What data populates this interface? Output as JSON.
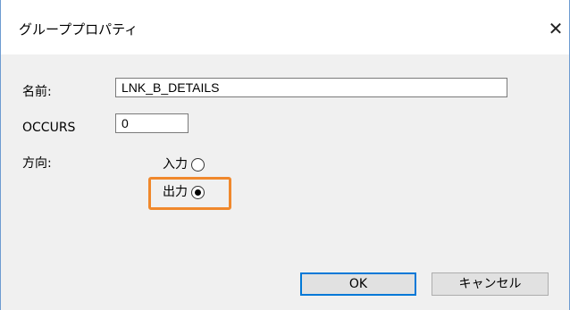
{
  "dialog": {
    "title": "グループプロパティ",
    "close_symbol": "✕"
  },
  "fields": {
    "name_label": "名前:",
    "name_value": "LNK_B_DETAILS",
    "occurs_label": "OCCURS",
    "occurs_value": "0",
    "direction_label": "方向:"
  },
  "direction": {
    "options": [
      {
        "label": "入力",
        "checked": false
      },
      {
        "label": "出力",
        "checked": true
      }
    ],
    "highlight_color": "#f0882c"
  },
  "buttons": {
    "ok_label": "OK",
    "cancel_label": "キャンセル"
  },
  "colors": {
    "window_border": "#6d9bd1",
    "default_button_border": "#0078d7"
  }
}
